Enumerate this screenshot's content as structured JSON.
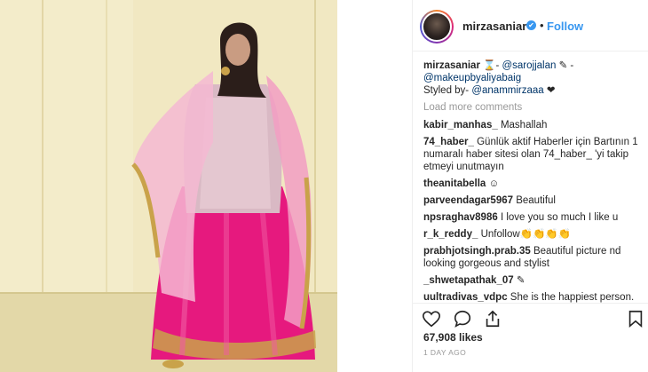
{
  "post": {
    "username": "mirzasaniar",
    "verified_glyph": "✔",
    "dot": "•",
    "follow_label": "Follow"
  },
  "caption": {
    "username": "mirzasaniar",
    "part1": " ⌛- ",
    "mention1": "@sarojjalan",
    "part2": " ✎ - ",
    "mention2": "@makeupbyaliyabaig",
    "part3": "Styled by- ",
    "mention3": "@anammirzaaa",
    "part4": " ❤"
  },
  "load_more": "Load more comments",
  "comments": [
    {
      "user": "kabir_manhas_",
      "text": " Mashallah"
    },
    {
      "user": "74_haber_",
      "text": " Günlük aktif Haberler için Bartının 1 numaralı haber sitesi olan 74_haber_ 'yi takip etmeyi unutmayın"
    },
    {
      "user": "theanitabella",
      "text": " ☺"
    },
    {
      "user": "parveendagar5967",
      "text": " Beautiful"
    },
    {
      "user": "npsraghav8986",
      "text": " I love you so much I like u"
    },
    {
      "user": "r_k_reddy_",
      "text": " Unfollow👏👏👏👏"
    },
    {
      "user": "prabhjotsingh.prab.35",
      "text": " Beautiful picture nd looking gorgeous and stylist"
    },
    {
      "user": "_shwetapathak_07",
      "text": " ✎"
    },
    {
      "user": "uultradivas_vdpc",
      "text": " She is the happiest person. She praying for Allah for the"
    }
  ],
  "actions": {
    "like_icon": "heart-icon",
    "comment_icon": "comment-icon",
    "share_icon": "share-icon",
    "save_icon": "bookmark-icon"
  },
  "likes": "67,908 likes",
  "time": "1 DAY AGO",
  "colors": {
    "link": "#003569",
    "follow": "#3897f0",
    "muted": "#999999",
    "dress_pink": "#e6197e"
  }
}
